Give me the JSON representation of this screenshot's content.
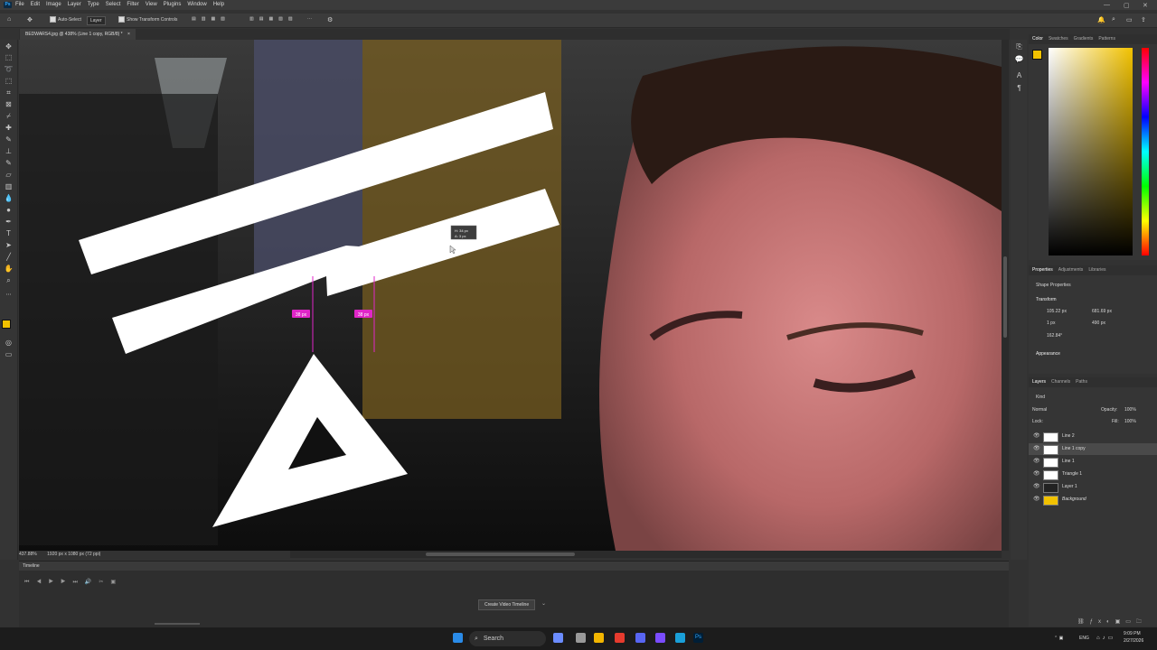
{
  "app": {
    "logo": "Ps"
  },
  "menu": [
    "File",
    "Edit",
    "Image",
    "Layer",
    "Type",
    "Select",
    "Filter",
    "View",
    "Plugins",
    "Window",
    "Help"
  ],
  "options": {
    "auto_select_label": "Auto-Select",
    "auto_select_value": "Layer",
    "transform_controls_label": "Show Transform Controls",
    "more": "···"
  },
  "document_tab": {
    "title": "BEDWARS4.jpg @ 438% (Line 1 copy, RGB/8) *",
    "close": "×"
  },
  "canvas_overlay": {
    "transform_tooltip_line1": "H: 34 px",
    "transform_tooltip_line2": "A: 3 px",
    "measure_left": "38 px",
    "measure_right": "38 px"
  },
  "status": {
    "zoom": "437.88%",
    "doc_size": "1920 px x 1080 px (72 ppi)"
  },
  "timeline": {
    "title": "Timeline",
    "create_button": "Create Video Timeline"
  },
  "color_panel": {
    "tabs": [
      "Color",
      "Swatches",
      "Gradients",
      "Patterns"
    ],
    "fg_color": "#f2c200",
    "bg_color": "#ffffff"
  },
  "properties": {
    "tabs": [
      "Properties",
      "Adjustments",
      "Libraries"
    ],
    "kind": "Shape Properties",
    "transform_label": "Transform",
    "w": "105.22 px",
    "x": "681.69 px",
    "h": "1 px",
    "y": "490 px",
    "angle": "162.84°",
    "appearance_label": "Appearance"
  },
  "layers_panel": {
    "tabs": [
      "Layers",
      "Channels",
      "Paths"
    ],
    "filter": "Kind",
    "blend": "Normal",
    "opacity_label": "Opacity:",
    "opacity": "100%",
    "lock_label": "Lock:",
    "fill_label": "Fill:",
    "fill": "100%",
    "layers": [
      {
        "name": "Line 2",
        "selected": false
      },
      {
        "name": "Line 1 copy",
        "selected": true
      },
      {
        "name": "Line 1",
        "selected": false
      },
      {
        "name": "Triangle 1",
        "selected": false
      },
      {
        "name": "Layer 1",
        "selected": false
      },
      {
        "name": "Background",
        "selected": false
      }
    ]
  },
  "taskbar": {
    "search": "Search",
    "lang": "ENG",
    "time": "9:09 PM",
    "date": "2/27/2026"
  }
}
